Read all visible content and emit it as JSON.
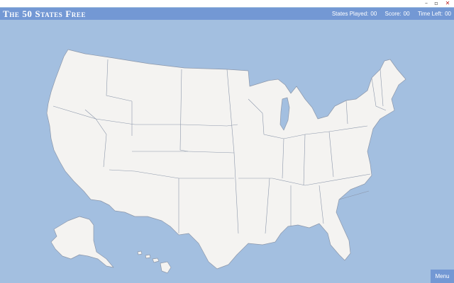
{
  "window": {
    "minimize_glyph": "–",
    "maximize_glyph": "▫",
    "close_glyph": "✕"
  },
  "header": {
    "title": "The 50 States Free",
    "states_played_label": "States Played:",
    "states_played_value": "00",
    "score_label": "Score:",
    "score_value": "00",
    "time_left_label": "Time Left:",
    "time_left_value": "00"
  },
  "menu": {
    "label": "Menu"
  },
  "colors": {
    "ocean": "#a3bfe0",
    "land": "#f4f3f1",
    "border": "#8c97aa",
    "header": "#7398d4",
    "text": "#ffffff"
  }
}
